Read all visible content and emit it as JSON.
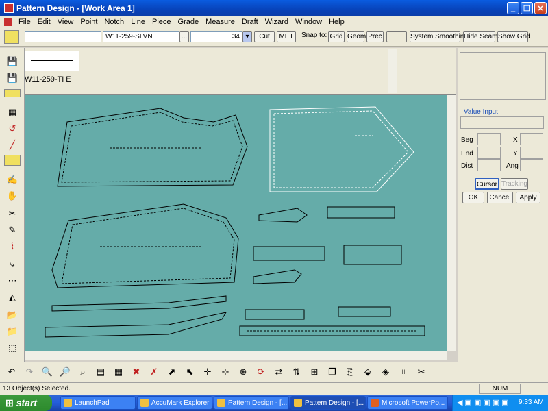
{
  "window": {
    "title": "Pattern Design - [Work Area 1]",
    "minimize": "_",
    "restore": "❐",
    "close": "✕"
  },
  "menu": [
    "File",
    "Edit",
    "View",
    "Point",
    "Notch",
    "Line",
    "Piece",
    "Grade",
    "Measure",
    "Draft",
    "Wizard",
    "Window",
    "Help"
  ],
  "toolbar": {
    "piece_field": "",
    "style_field": "W11-259-SLVN",
    "browse": "...",
    "size_value": "34",
    "cut_label": "Cut",
    "units_label": "MET",
    "snap_label": "Snap to:",
    "grid_label": "Grid",
    "geom_label": "Geom",
    "prec_label": "Prec",
    "system_smoothing_label": "System Smoothing",
    "hide_seams_label": "Hide Seams",
    "show_grid_label": "Show Grid"
  },
  "preview": {
    "piece_name": "W11-259-TI E"
  },
  "value_input": {
    "title": "Value Input",
    "beg": "Beg",
    "end": "End",
    "dist": "Dist",
    "x": "X",
    "y": "Y",
    "ang": "Ang",
    "cursor": "Cursor",
    "tracking": "Tracking",
    "ok": "OK",
    "cancel": "Cancel",
    "apply": "Apply"
  },
  "status": {
    "message": "13 Object(s) Selected.",
    "num": "NUM"
  },
  "taskbar": {
    "start": "start",
    "tasks": [
      "LaunchPad",
      "AccuMark Explorer",
      "Pattern Design - [...",
      "Pattern Design - [...",
      "Microsoft PowerPo..."
    ],
    "clock": "9:33 AM"
  },
  "colors": {
    "canvas": "#65aca9",
    "title_bar": "#0a5ce0",
    "taskbar": "#245edb"
  }
}
